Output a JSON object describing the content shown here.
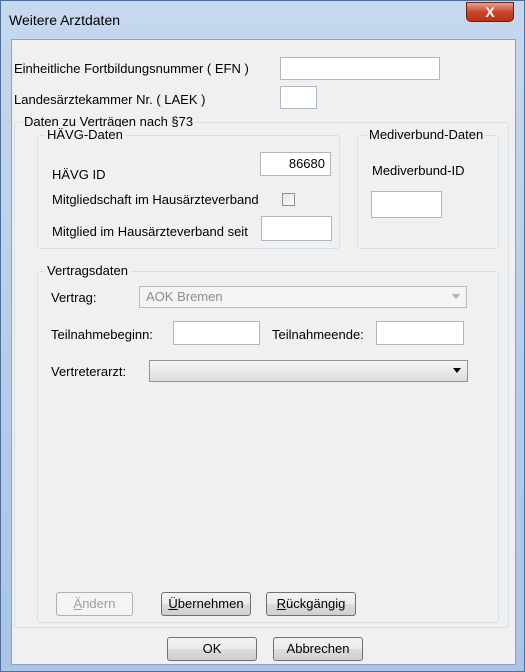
{
  "window": {
    "title": "Weitere Arztdaten",
    "close_symbol": "X"
  },
  "top_fields": {
    "efn_label": "Einheitliche Fortbildungsnummer ( EFN )",
    "efn_value": "",
    "laek_label": "Landesärztekammer Nr. ( LAEK )",
    "laek_value": ""
  },
  "vertraege_group": {
    "title": "Daten zu Verträgen nach §73",
    "haevg": {
      "title": "HÄVG-Daten",
      "id_label": "HÄVG ID",
      "id_value": "86680",
      "membership_label": "Mitgliedschaft im Hausärzteverband",
      "membership_checked": false,
      "member_since_label": "Mitglied im Hausärzteverband seit",
      "member_since_value": ""
    },
    "mediverbund": {
      "title": "Mediverbund-Daten",
      "id_label": "Mediverbund-ID",
      "id_value": ""
    },
    "vertragsdaten": {
      "title": "Vertragsdaten",
      "vertrag_label": "Vertrag:",
      "vertrag_value": "AOK Bremen",
      "start_label": "Teilnahmebeginn:",
      "start_value": "",
      "end_label": "Teilnahmeende:",
      "end_value": "",
      "vertreter_label": "Vertreterarzt:",
      "vertreter_value": ""
    },
    "buttons": {
      "aendern": {
        "first": "Ä",
        "rest": "ndern"
      },
      "uebernehmen": {
        "first": "Ü",
        "rest": "bernehmen"
      },
      "rueckgaengig": {
        "first": "R",
        "rest": "ückgängig"
      }
    }
  },
  "footer": {
    "ok_label": "OK",
    "cancel_label": "Abbrechen"
  }
}
